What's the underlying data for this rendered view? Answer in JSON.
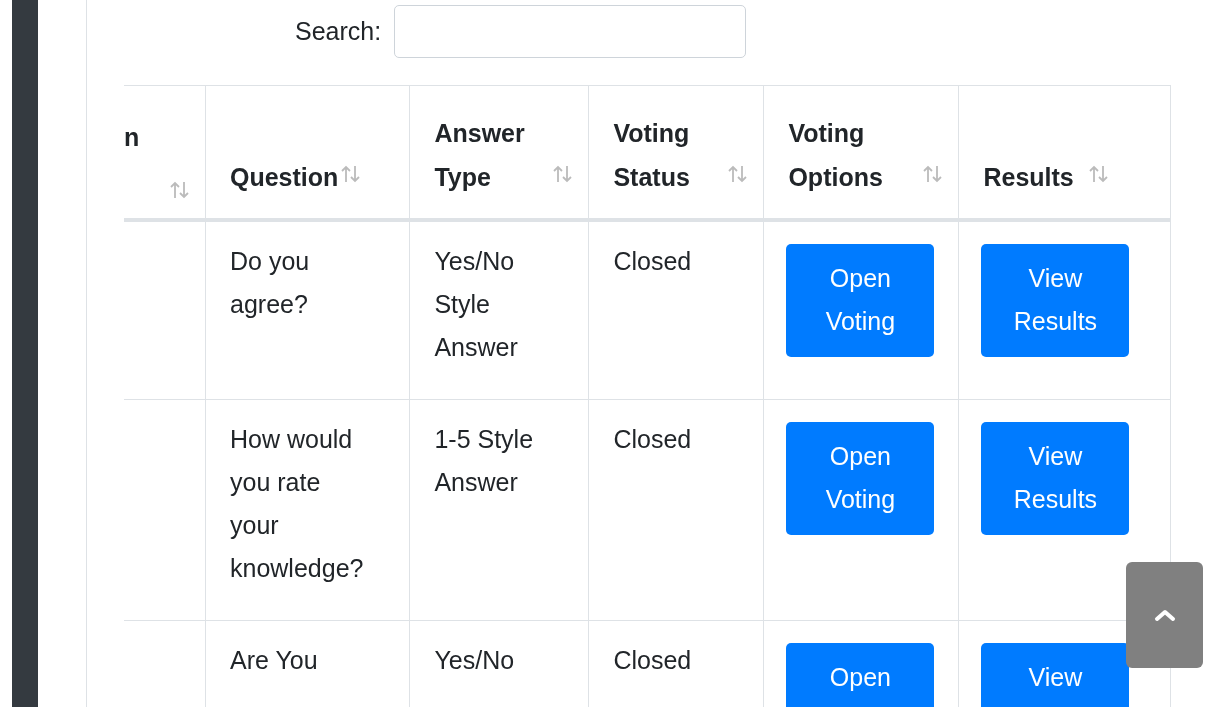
{
  "search": {
    "label": "Search:"
  },
  "table": {
    "columns": [
      {
        "label": "n"
      },
      {
        "label": "Question"
      },
      {
        "label": "Answer Type"
      },
      {
        "label": "Voting Status"
      },
      {
        "label": "Voting Options"
      },
      {
        "label": "Results"
      }
    ],
    "rows": [
      {
        "question": "Do you agree?",
        "answer_type": "Yes/No Style Answer",
        "status": "Closed",
        "voting_button": "Open Voting",
        "results_button": "View Results"
      },
      {
        "question": "How would you rate your knowledge?",
        "answer_type": "1-5 Style Answer",
        "status": "Closed",
        "voting_button": "Open Voting",
        "results_button": "View Results"
      },
      {
        "question": "Are You",
        "answer_type": "Yes/No",
        "status": "Closed",
        "voting_button": "Open",
        "results_button": "View"
      }
    ]
  }
}
